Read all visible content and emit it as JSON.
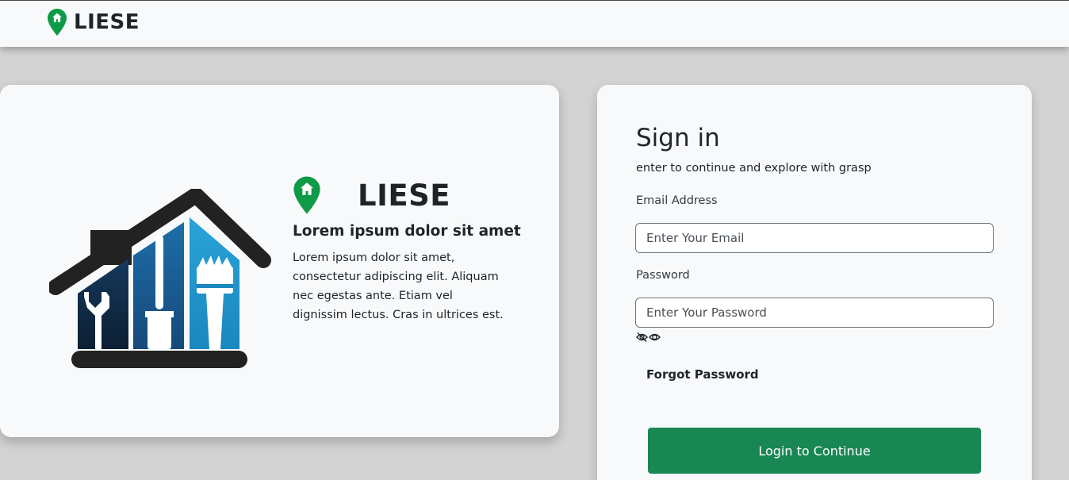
{
  "brand": {
    "name": "LIESE",
    "accent_color": "#0f9a48",
    "logo_icon": "location-home-pin-icon"
  },
  "info_card": {
    "illustration": "house-tools-illustration",
    "brand_name": "LIESE",
    "heading": "Lorem ipsum dolor sit amet",
    "body": "Lorem ipsum dolor sit amet, consectetur adipiscing elit. Aliquam nec egestas ante. Etiam vel dignissim lectus. Cras in ultrices est."
  },
  "signin": {
    "title": "Sign in",
    "subtitle": "enter to continue and explore with grasp",
    "email_label": "Email Address",
    "email_placeholder": "Enter Your Email",
    "email_value": "",
    "password_label": "Password",
    "password_placeholder": "Enter Your Password",
    "password_value": "",
    "password_toggle_icon": "eye-toggle-icon",
    "forgot_label": "Forgot Password",
    "login_label": "Login to Continue",
    "login_color": "#198754"
  }
}
